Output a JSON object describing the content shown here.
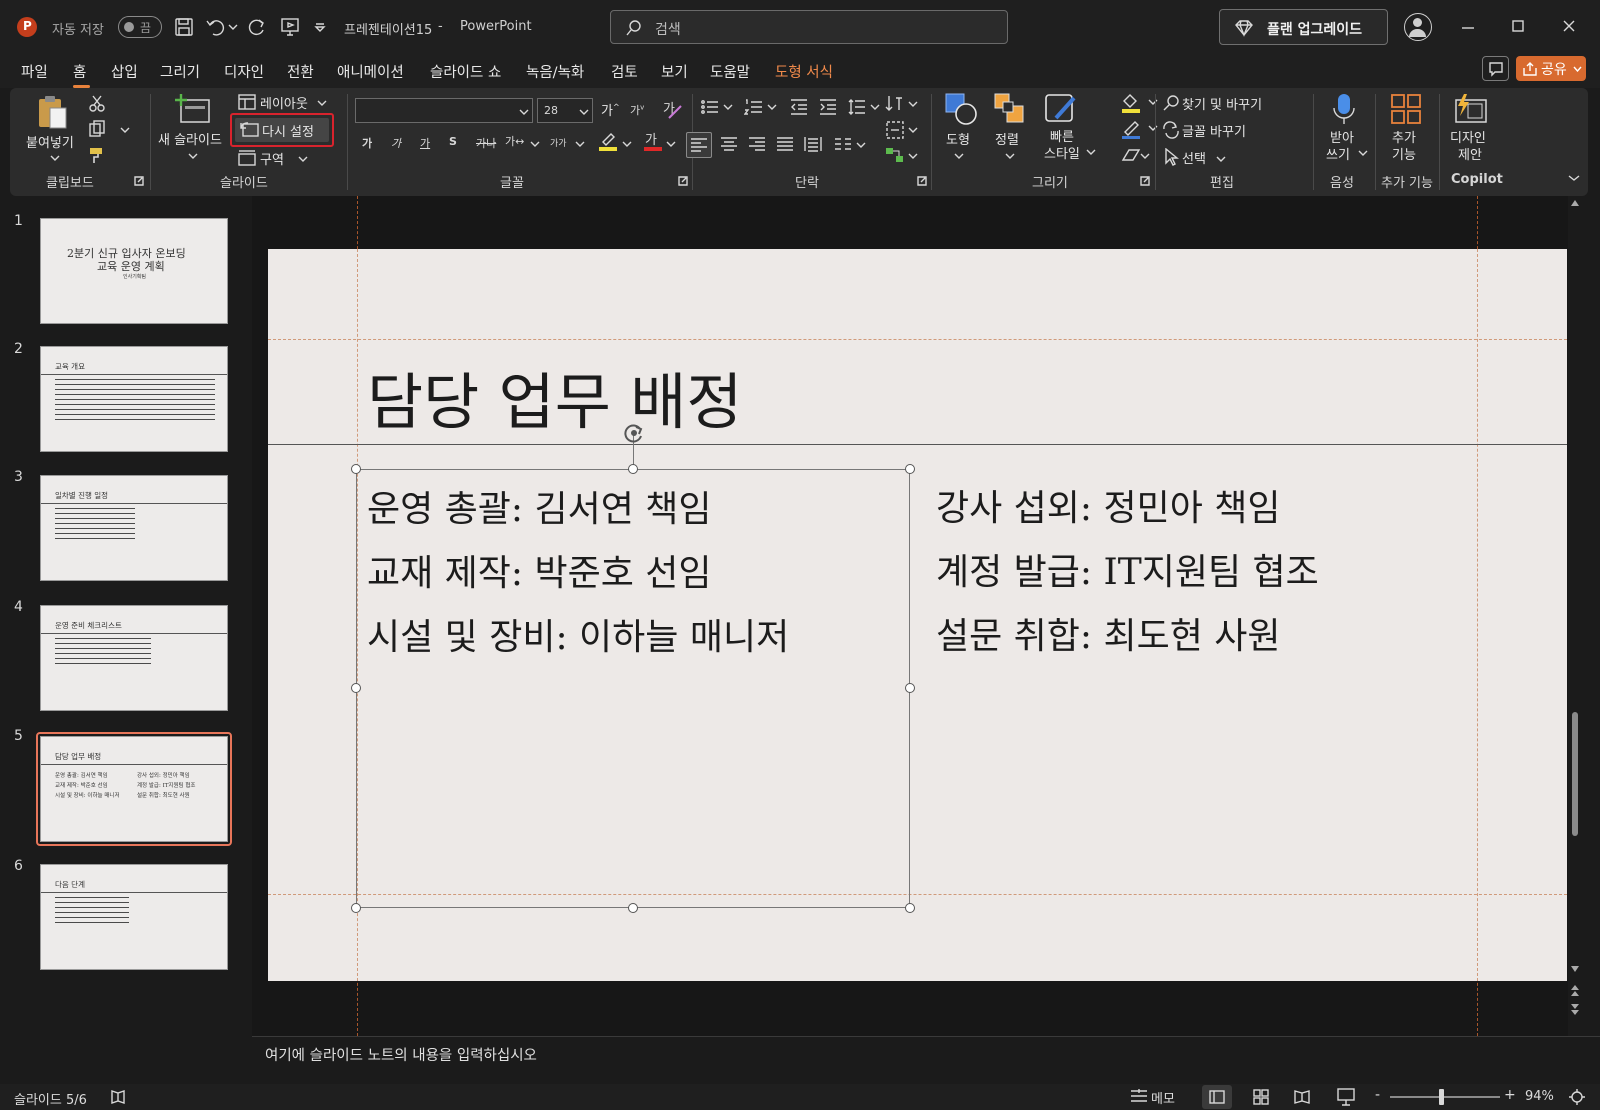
{
  "titlebar": {
    "autosave_label": "자동 저장",
    "autosave_state": "끔",
    "document_title": "프레젠테이션15",
    "app_name": "PowerPoint",
    "separator": "-",
    "search_placeholder": "검색",
    "upgrade_label": "플랜 업그레이드"
  },
  "menu": {
    "items": [
      "파일",
      "홈",
      "삽입",
      "그리기",
      "디자인",
      "전환",
      "애니메이션",
      "슬라이드 쇼",
      "녹음/녹화",
      "검토",
      "보기",
      "도움말"
    ],
    "contextual": "도형 서식",
    "share_label": "공유"
  },
  "ribbon": {
    "clipboard": {
      "paste": "붙여넣기",
      "group": "클립보드"
    },
    "slides": {
      "new_slide": "새 슬라이드",
      "layout": "레이아웃",
      "reset": "다시 설정",
      "section": "구역",
      "group": "슬라이드"
    },
    "font": {
      "font_name": "",
      "font_size": "28",
      "bold": "가",
      "italic": "가",
      "underline": "가",
      "shadow": "S",
      "strike": "가나",
      "spacing": "가↔",
      "case": "가가",
      "group": "글꼴"
    },
    "paragraph": {
      "group": "단락"
    },
    "drawing": {
      "shapes": "도형",
      "arrange": "정렬",
      "quick_styles_1": "빠른",
      "quick_styles_2": "스타일",
      "group": "그리기"
    },
    "editing": {
      "find_replace": "찾기 및 바꾸기",
      "replace_font": "글꼴 바꾸기",
      "select": "선택",
      "group": "편집"
    },
    "voice": {
      "dictate_1": "받아",
      "dictate_2": "쓰기",
      "group": "음성"
    },
    "addins": {
      "label_1": "추가",
      "label_2": "기능",
      "group": "추가 기능"
    },
    "designer": {
      "label_1": "디자인",
      "label_2": "제안",
      "group": "Copilot"
    }
  },
  "thumbnails": [
    {
      "num": "1",
      "title_1": "2분기 신규 입사자 온보딩",
      "title_2": "교육 운영 계획",
      "subtitle": "인사기획팀"
    },
    {
      "num": "2",
      "title": "교육 개요"
    },
    {
      "num": "3",
      "title": "일차별 진행 일정"
    },
    {
      "num": "4",
      "title": "운영 준비 체크리스트"
    },
    {
      "num": "5",
      "title": "담당 업무 배정",
      "left": [
        "운영 총괄: 김서연 책임",
        "교재 제작: 박준호 선임",
        "시설 및 장비: 이하늘 매니저"
      ],
      "right": [
        "강사 섭외: 정민아 책임",
        "계정 발급: IT지원팀 협조",
        "설문 취합: 최도현 사원"
      ]
    },
    {
      "num": "6",
      "title": "다음 단계"
    }
  ],
  "slide": {
    "title": "담당 업무 배정",
    "left_column": [
      "운영 총괄: 김서연 책임",
      "교재 제작: 박준호 선임",
      "시설 및 장비: 이하늘 매니저"
    ],
    "right_column": [
      "강사 섭외: 정민아 책임",
      "계정 발급: IT지원팀 협조",
      "설문 취합: 최도현 사원"
    ]
  },
  "notes_placeholder": "여기에 슬라이드 노트의 내용을 입력하십시오",
  "status": {
    "slide_indicator": "슬라이드 5/6",
    "notes_label": "메모",
    "zoom": "94%",
    "zoom_minus": "-",
    "zoom_plus": "+"
  },
  "colors": {
    "accent": "#e8823c",
    "highlight_box": "#d9232d",
    "background": "#1b1b1b",
    "ribbon": "#2c2c2c",
    "slide_bg": "#ede9e7"
  }
}
